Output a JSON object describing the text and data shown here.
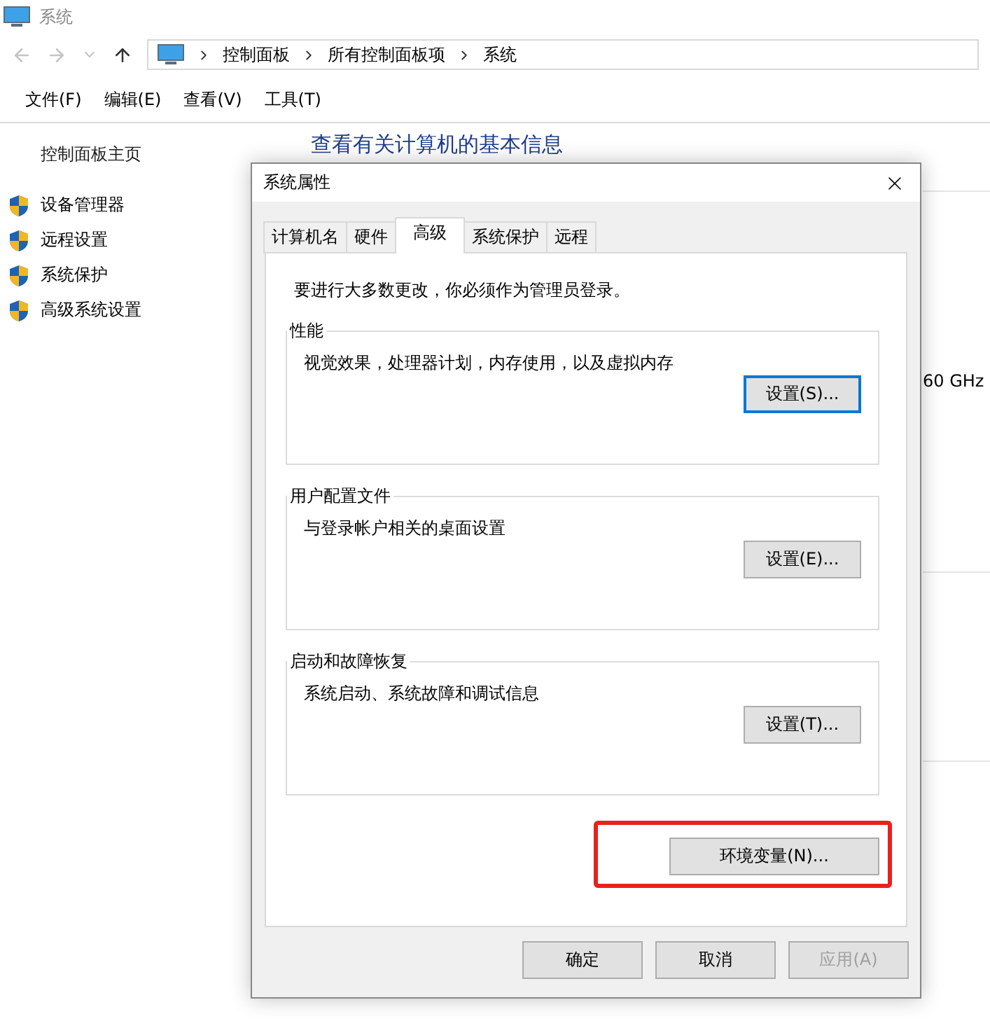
{
  "window": {
    "title": "系统"
  },
  "breadcrumb": [
    "控制面板",
    "所有控制面板项",
    "系统"
  ],
  "menu": [
    "文件(F)",
    "编辑(E)",
    "查看(V)",
    "工具(T)"
  ],
  "sidebar": {
    "home": "控制面板主页",
    "items": [
      "设备管理器",
      "远程设置",
      "系统保护",
      "高级系统设置"
    ]
  },
  "main": {
    "heading": "查看有关计算机的基本信息",
    "cpu_speed": "60 GHz"
  },
  "dialog": {
    "title": "系统属性",
    "tabs": [
      {
        "label": "计算机名",
        "selected": false
      },
      {
        "label": "硬件",
        "selected": false
      },
      {
        "label": "高级",
        "selected": true
      },
      {
        "label": "系统保护",
        "selected": false
      },
      {
        "label": "远程",
        "selected": false
      }
    ],
    "notice": "要进行大多数更改，你必须作为管理员登录。",
    "groups": [
      {
        "title": "性能",
        "description": "视觉效果，处理器计划，内存使用，以及虚拟内存",
        "button": {
          "label": "设置(S)...",
          "focused": true
        }
      },
      {
        "title": "用户配置文件",
        "description": "与登录帐户相关的桌面设置",
        "button": {
          "label": "设置(E)...",
          "focused": false
        }
      },
      {
        "title": "启动和故障恢复",
        "description": "系统启动、系统故障和调试信息",
        "button": {
          "label": "设置(T)...",
          "focused": false
        }
      }
    ],
    "env_button": {
      "label": "环境变量(N)...",
      "highlighted": true
    },
    "buttons": [
      {
        "label": "确定",
        "disabled": false
      },
      {
        "label": "取消",
        "disabled": false
      },
      {
        "label": "应用(A)",
        "disabled": true
      }
    ]
  }
}
